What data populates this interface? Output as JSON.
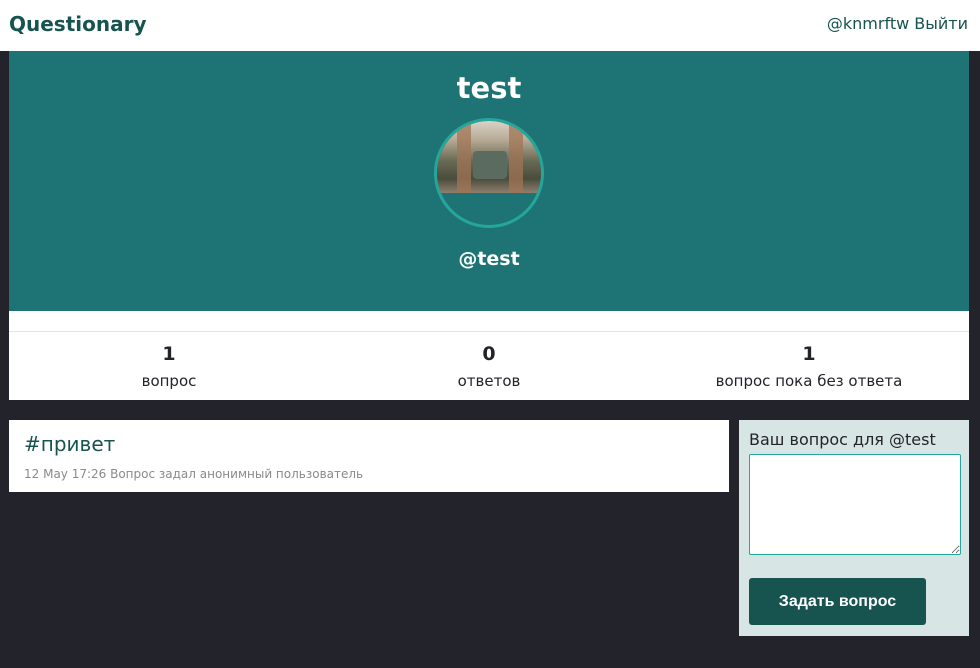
{
  "navbar": {
    "brand": "Questionary",
    "current_user": "@knmrftw",
    "logout_label": "Выйти"
  },
  "profile": {
    "name": "test",
    "handle": "@test"
  },
  "stats": [
    {
      "value": "1",
      "label": "вопрос"
    },
    {
      "value": "0",
      "label": "ответов"
    },
    {
      "value": "1",
      "label": "вопрос пока без ответа"
    }
  ],
  "questions": [
    {
      "text": "#привет",
      "meta": "12 May 17:26 Вопрос задал анонимный пользователь"
    }
  ],
  "ask_form": {
    "label": "Ваш вопрос для @test",
    "textarea_value": "",
    "submit_label": "Задать вопрос"
  },
  "colors": {
    "brand_dark": "#175450",
    "hero_bg": "#1e7474",
    "accent": "#26a69a",
    "page_bg": "#22232b",
    "form_bg": "#d8e5e5"
  }
}
